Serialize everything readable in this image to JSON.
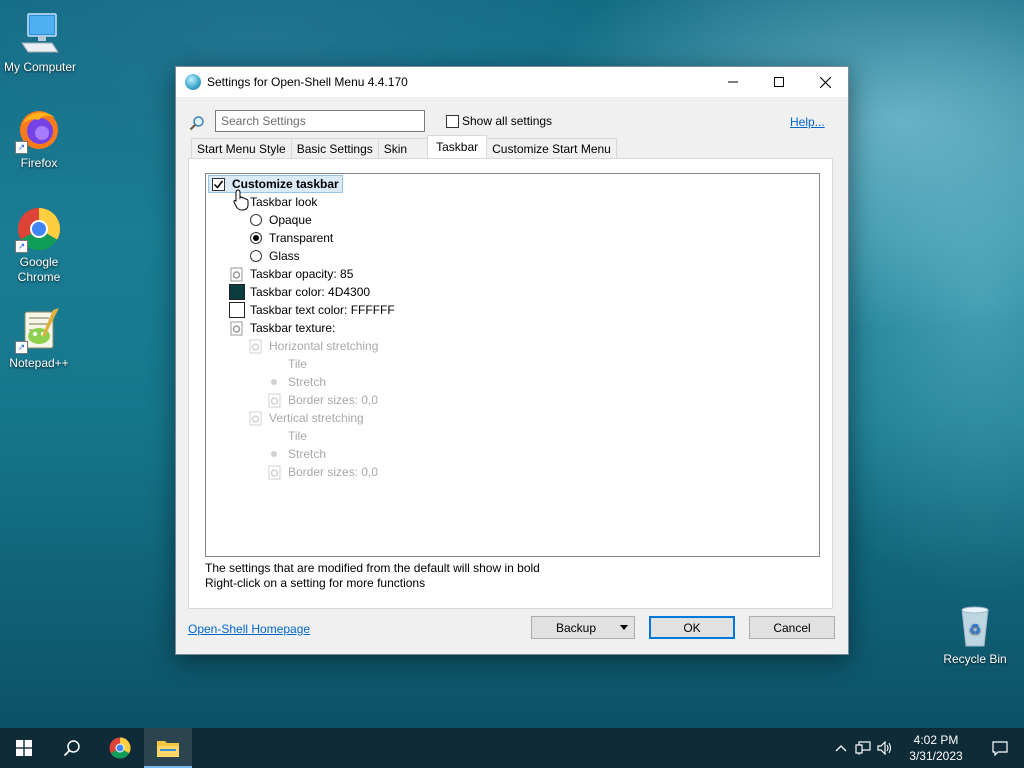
{
  "desktop": {
    "icons": [
      {
        "label": "My Computer",
        "icon": "computer-icon"
      },
      {
        "label": "Firefox",
        "icon": "firefox-icon"
      },
      {
        "label": "Google Chrome",
        "icon": "chrome-icon"
      },
      {
        "label": "Notepad++",
        "icon": "notepad-plus-plus-icon"
      },
      {
        "label": "Recycle Bin",
        "icon": "recycle-bin-icon"
      }
    ]
  },
  "window": {
    "title": "Settings for Open-Shell Menu 4.4.170",
    "search_placeholder": "Search Settings",
    "show_all_label": "Show all settings",
    "help_label": "Help...",
    "tabs": [
      {
        "label": "Start Menu Style"
      },
      {
        "label": "Basic Settings"
      },
      {
        "label": "Skin"
      },
      {
        "label": "Taskbar",
        "active": true
      },
      {
        "label": "Customize Start Menu"
      }
    ],
    "tree": {
      "customize_taskbar": "Customize taskbar",
      "taskbar_look": "Taskbar look",
      "opaque": "Opaque",
      "transparent": "Transparent",
      "glass": "Glass",
      "opacity": "Taskbar opacity: 85",
      "color": "Taskbar color: 4D4300",
      "text_color": "Taskbar text color: FFFFFF",
      "texture": "Taskbar texture:",
      "horizontal_stretching": "Horizontal stretching",
      "h_tile": "Tile",
      "h_stretch": "Stretch",
      "h_border": "Border sizes: 0,0",
      "vertical_stretching": "Vertical stretching",
      "v_tile": "Tile",
      "v_stretch": "Stretch",
      "v_border": "Border sizes: 0,0"
    },
    "colors": {
      "taskbar_swatch": "#0b3c40",
      "text_swatch": "#ffffff"
    },
    "info_line1": "The settings that are modified from the default will show in bold",
    "info_line2": "Right-click on a setting for more functions",
    "homepage_link": "Open-Shell Homepage",
    "buttons": {
      "backup": "Backup",
      "ok": "OK",
      "cancel": "Cancel"
    }
  },
  "taskbar": {
    "time": "4:02 PM",
    "date": "3/31/2023"
  }
}
